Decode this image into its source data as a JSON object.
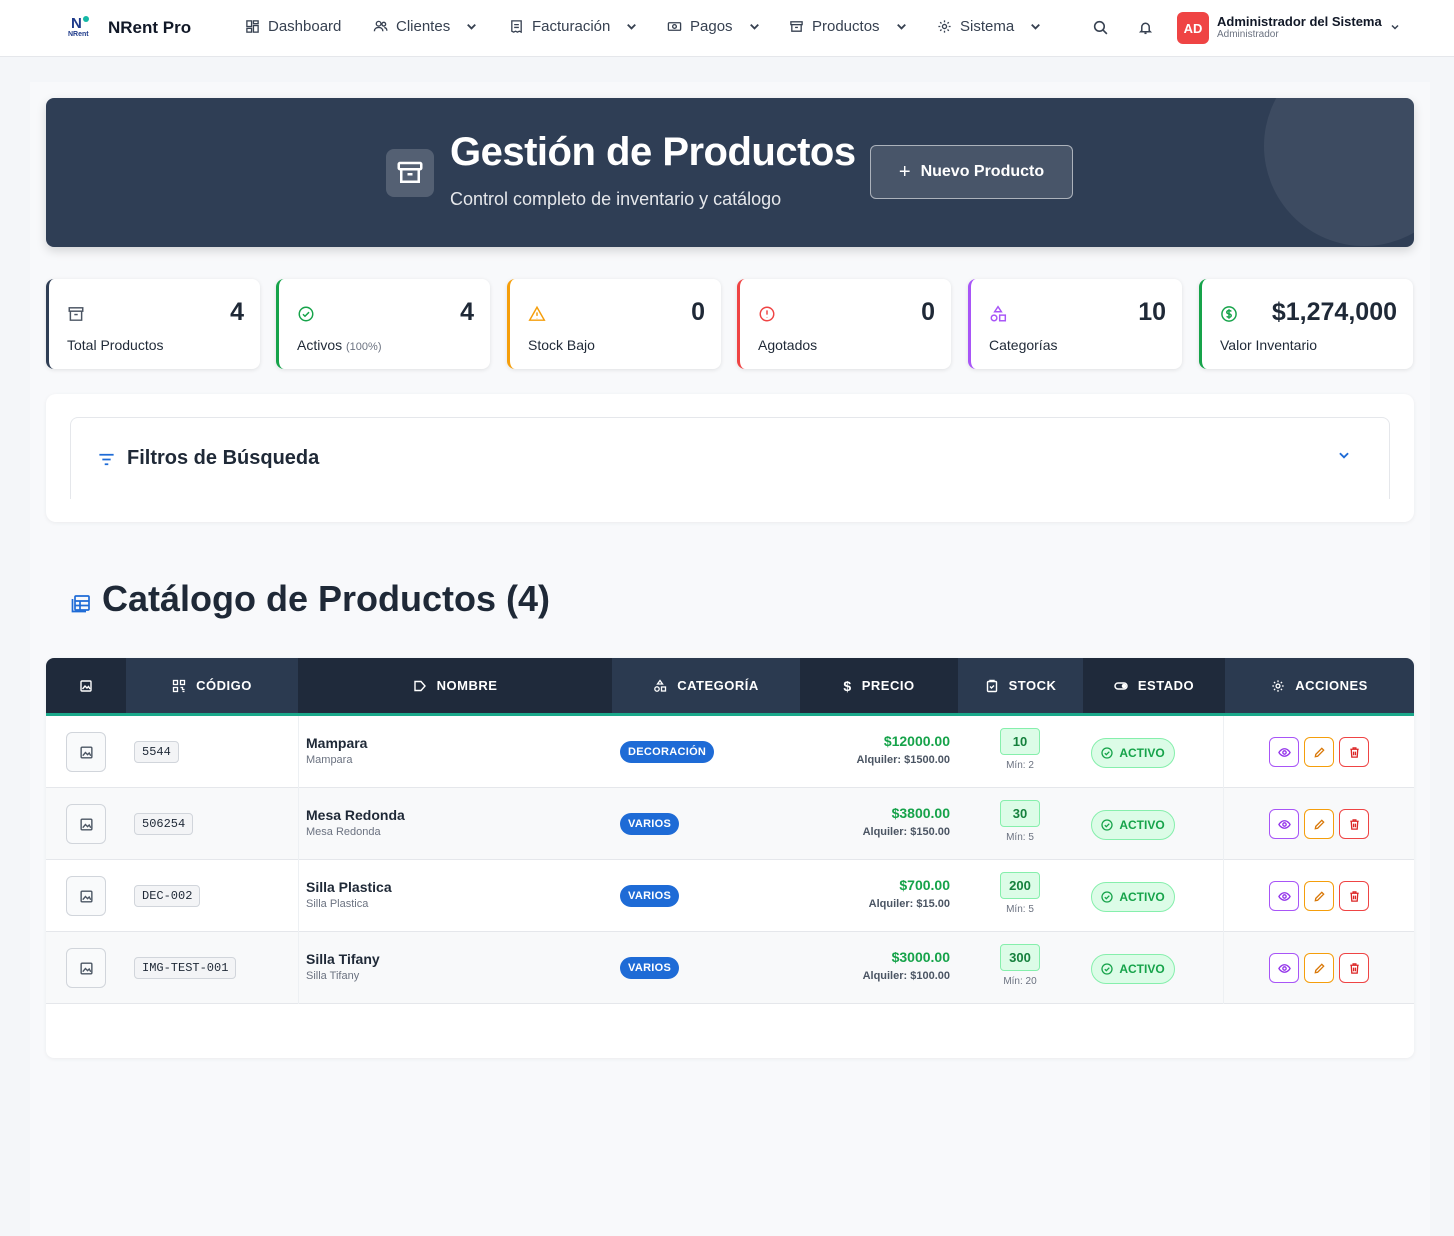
{
  "nav": {
    "brand": "NRent Pro",
    "logo_text": "NRent",
    "items": [
      {
        "label": "Dashboard",
        "icon": "dashboard-icon"
      },
      {
        "label": "Clientes",
        "icon": "users-icon"
      },
      {
        "label": "Facturación",
        "icon": "invoice-icon"
      },
      {
        "label": "Pagos",
        "icon": "money-icon"
      },
      {
        "label": "Productos",
        "icon": "box-icon"
      },
      {
        "label": "Sistema",
        "icon": "gear-icon"
      }
    ],
    "user": {
      "initials": "AD",
      "name": "Administrador del Sistema",
      "role": "Administrador"
    }
  },
  "hero": {
    "title": "Gestión de Productos",
    "subtitle": "Control completo de inventario y catálogo",
    "button": "Nuevo Producto"
  },
  "stats": [
    {
      "value": "4",
      "label": "Total Productos",
      "color": "#2f3e55"
    },
    {
      "value": "4",
      "label": "Activos",
      "note": "(100%)",
      "color": "#16a34a"
    },
    {
      "value": "0",
      "label": "Stock Bajo",
      "color": "#f59e0b"
    },
    {
      "value": "0",
      "label": "Agotados",
      "color": "#ef4444"
    },
    {
      "value": "10",
      "label": "Categorías",
      "color": "#a855f7"
    },
    {
      "value": "$1,274,000",
      "label": "Valor Inventario",
      "color": "#16a34a"
    }
  ],
  "filters": {
    "title": "Filtros de Búsqueda"
  },
  "catalog": {
    "title": "Catálogo de Productos (4)"
  },
  "table": {
    "headers": [
      "CÓDIGO",
      "NOMBRE",
      "CATEGORÍA",
      "PRECIO",
      "STOCK",
      "ESTADO",
      "ACCIONES"
    ],
    "rows": [
      {
        "code": "5544",
        "name": "Mampara",
        "sub": "Mampara",
        "category": "DECORACIÓN",
        "price": "$12000.00",
        "rent": "Alquiler: $1500.00",
        "stock": "10",
        "min": "Mín: 2",
        "status": "ACTIVO"
      },
      {
        "code": "506254",
        "name": "Mesa Redonda",
        "sub": "Mesa Redonda",
        "category": "VARIOS",
        "price": "$3800.00",
        "rent": "Alquiler: $150.00",
        "stock": "30",
        "min": "Mín: 5",
        "status": "ACTIVO"
      },
      {
        "code": "DEC-002",
        "name": "Silla Plastica",
        "sub": "Silla Plastica",
        "category": "VARIOS",
        "price": "$700.00",
        "rent": "Alquiler: $15.00",
        "stock": "200",
        "min": "Mín: 5",
        "status": "ACTIVO"
      },
      {
        "code": "IMG-TEST-001",
        "name": "Silla Tifany",
        "sub": "Silla Tifany",
        "category": "VARIOS",
        "price": "$3000.00",
        "rent": "Alquiler: $100.00",
        "stock": "300",
        "min": "Mín: 20",
        "status": "ACTIVO"
      }
    ]
  }
}
